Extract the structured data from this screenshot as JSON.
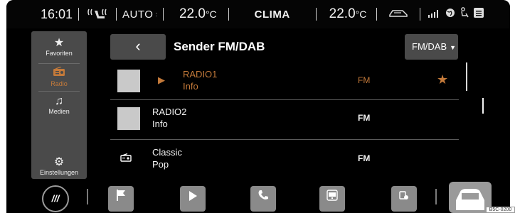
{
  "status_bar": {
    "time": "16:01",
    "seat_heating_icon": "seat-heating-icon",
    "auto": "AUTO",
    "temp_left": "22.0",
    "temp_left_unit": "°C",
    "clima": "CLIMA",
    "temp_right": "22.0",
    "temp_right_unit": "°C",
    "icons": [
      "car-air-icon",
      "signal-icon",
      "globe-icon",
      "seat-icon",
      "menu-icon"
    ]
  },
  "sidebar": {
    "items": [
      {
        "label": "Favoriten",
        "icon": "star-icon"
      },
      {
        "label": "Radio",
        "icon": "radio-icon"
      },
      {
        "label": "Medien",
        "icon": "music-icon"
      },
      {
        "label": "Einstellungen",
        "icon": "gear-icon"
      }
    ]
  },
  "header": {
    "back_label": "‹",
    "title": "Sender FM/DAB",
    "band_select": "FM/DAB"
  },
  "stations": [
    {
      "name": "RADIO1",
      "info": "Info",
      "band": "FM",
      "active": true,
      "favorite": true
    },
    {
      "name": "RADIO2",
      "info": "Info",
      "band": "FM",
      "active": false,
      "favorite": false
    },
    {
      "name": "Classic",
      "info": "Pop",
      "band": "FM",
      "active": false,
      "favorite": false
    }
  ],
  "bottom_bar": {
    "home_label": "///",
    "tiles": [
      "flag-icon",
      "play-icon",
      "phone-icon",
      "app-connect-icon",
      "vehicle-settings-icon",
      "car-icon"
    ]
  },
  "figure_tag": "B5C-0200"
}
